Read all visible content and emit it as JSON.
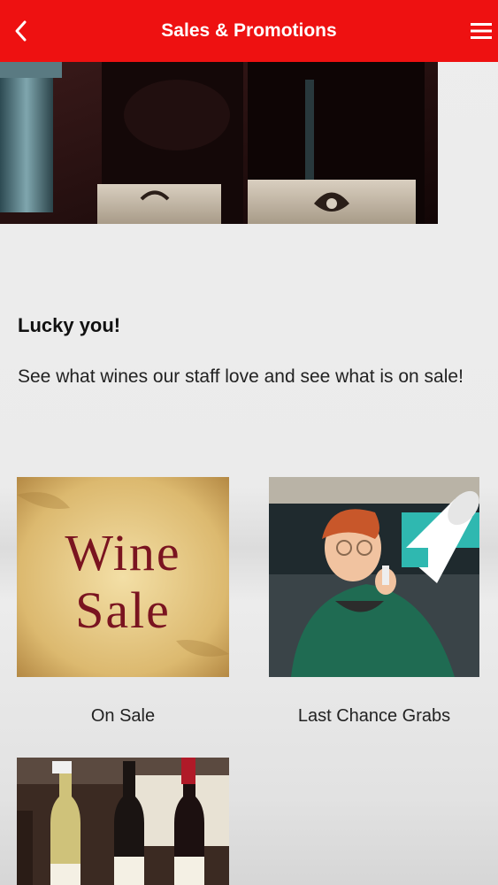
{
  "header": {
    "title": "Sales & Promotions",
    "back_icon": "chevron-left-icon",
    "menu_icon": "hamburger-menu-icon",
    "color": "#ee1111"
  },
  "intro": {
    "heading": "Lucky you!",
    "text": "See what wines our staff love and see what is on sale!"
  },
  "tiles": [
    {
      "label": "On Sale",
      "image_text_line1": "Wine",
      "image_text_line2": "Sale"
    },
    {
      "label": "Last Chance Grabs"
    },
    {
      "label": ""
    }
  ]
}
